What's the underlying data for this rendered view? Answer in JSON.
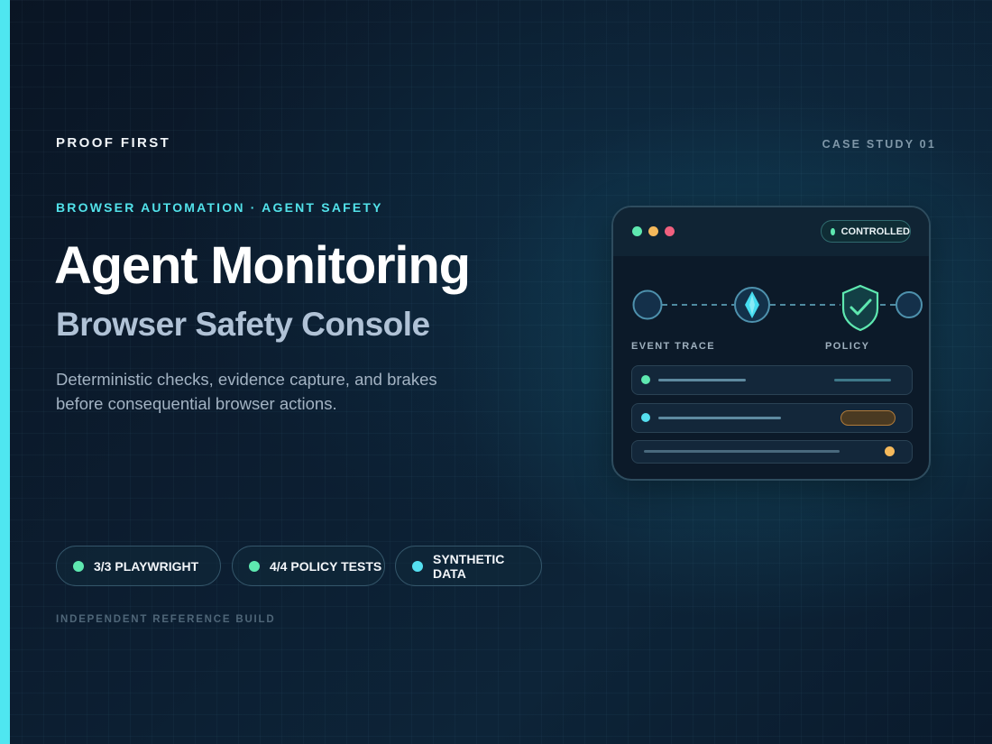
{
  "brand": "PROOF FIRST",
  "case_label": "CASE STUDY 01",
  "eyebrow": "BROWSER AUTOMATION · AGENT SAFETY",
  "title": "Agent Monitoring",
  "subtitle": "Browser Safety Console",
  "description": "Deterministic checks, evidence capture, and brakes before consequential browser actions.",
  "badges": [
    {
      "label": "3/3 PLAYWRIGHT",
      "dot_color": "#5ee8b0"
    },
    {
      "label": "4/4 POLICY TESTS",
      "dot_color": "#5ee8b0"
    },
    {
      "label": "SYNTHETIC DATA",
      "dot_color": "#55dff0"
    }
  ],
  "footnote": "INDEPENDENT REFERENCE BUILD",
  "console": {
    "status": "CONTROLLED",
    "status_color": "#5ee8b0",
    "window_dots": [
      "#5ee8b0",
      "#f5b95b",
      "#f0607e"
    ],
    "trace": {
      "nodes": [
        "circle",
        "diamond-icon",
        "shield-check-icon",
        "circle"
      ],
      "left_label": "EVENT TRACE",
      "right_label": "POLICY"
    },
    "rows": [
      {
        "dot_color": "#5ee8b0"
      },
      {
        "dot_color": "#55dff0"
      },
      {
        "dot_color": "#f5b95b"
      }
    ]
  },
  "colors": {
    "accent": "#4fe6f0",
    "background": "#0b1a2b",
    "subtitle": "#b0c2d6"
  }
}
